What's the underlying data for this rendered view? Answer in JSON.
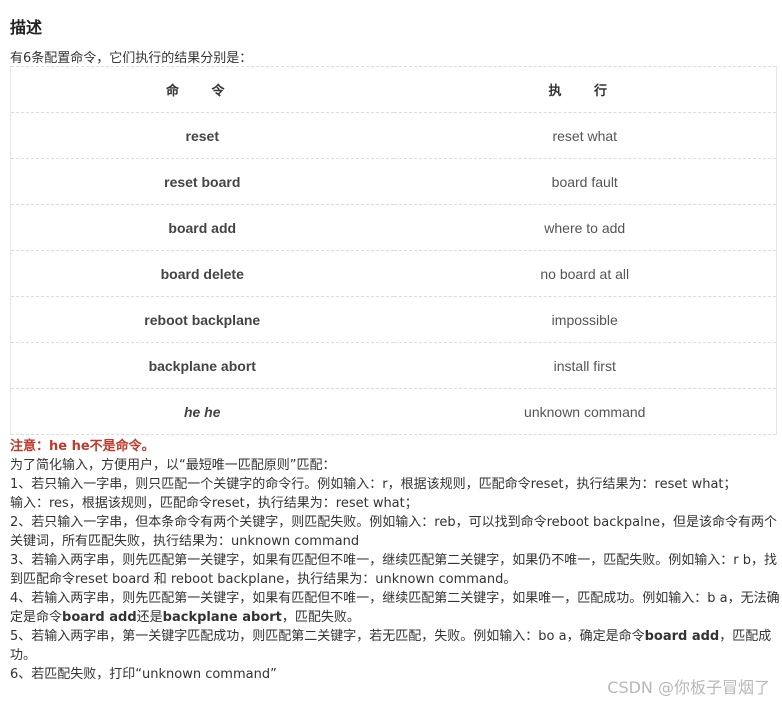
{
  "heading": "描述",
  "intro": "有6条配置命令，它们执行的结果分别是：",
  "table": {
    "headers": [
      "命 令",
      "执 行"
    ],
    "rows": [
      {
        "command": "reset",
        "result": "reset what"
      },
      {
        "command": "reset board",
        "result": "board fault"
      },
      {
        "command": "board add",
        "result": "where to add"
      },
      {
        "command": "board delete",
        "result": "no board at all"
      },
      {
        "command": "reboot backplane",
        "result": "impossible"
      },
      {
        "command": "backplane abort",
        "result": "install first"
      },
      {
        "command": "he he",
        "result": "unknown command"
      }
    ]
  },
  "note": "注意：he he不是命令。",
  "rules": {
    "intro": "为了简化输入，方便用户，以“最短唯一匹配原则”匹配：",
    "r1a": "1、若只输入一字串，则只匹配一个关键字的命令行。例如输入：r，根据该规则，匹配命令reset，执行结果为：reset what；",
    "r1b": "输入：res，根据该规则，匹配命令reset，执行结果为：reset what；",
    "r2": "2、若只输入一字串，但本条命令有两个关键字，则匹配失败。例如输入：reb，可以找到命令reboot backpalne，但是该命令有两个关键词，所有匹配失败，执行结果为：unknown command",
    "r3": "3、若输入两字串，则先匹配第一关键字，如果有匹配但不唯一，继续匹配第二关键字，如果仍不唯一，匹配失败。例如输入：r b，找到匹配命令reset board 和 reboot backplane，执行结果为：unknown command。",
    "r4_pre": "4、若输入两字串，则先匹配第一关键字，如果有匹配但不唯一，继续匹配第二关键字，如果唯一，匹配成功。例如输入：b a，无法确定是命令",
    "r4_b1": "board add",
    "r4_mid": "还是",
    "r4_b2": "backplane abort",
    "r4_post": "，匹配失败。",
    "r5_pre": "5、若输入两字串，第一关键字匹配成功，则匹配第二关键字，若无匹配，失败。例如输入：bo a，确定是命令",
    "r5_b": "board add",
    "r5_post": "，匹配成功。",
    "r6": "6、若匹配失败，打印“unknown command”"
  },
  "watermark": "CSDN @你板子冒烟了"
}
